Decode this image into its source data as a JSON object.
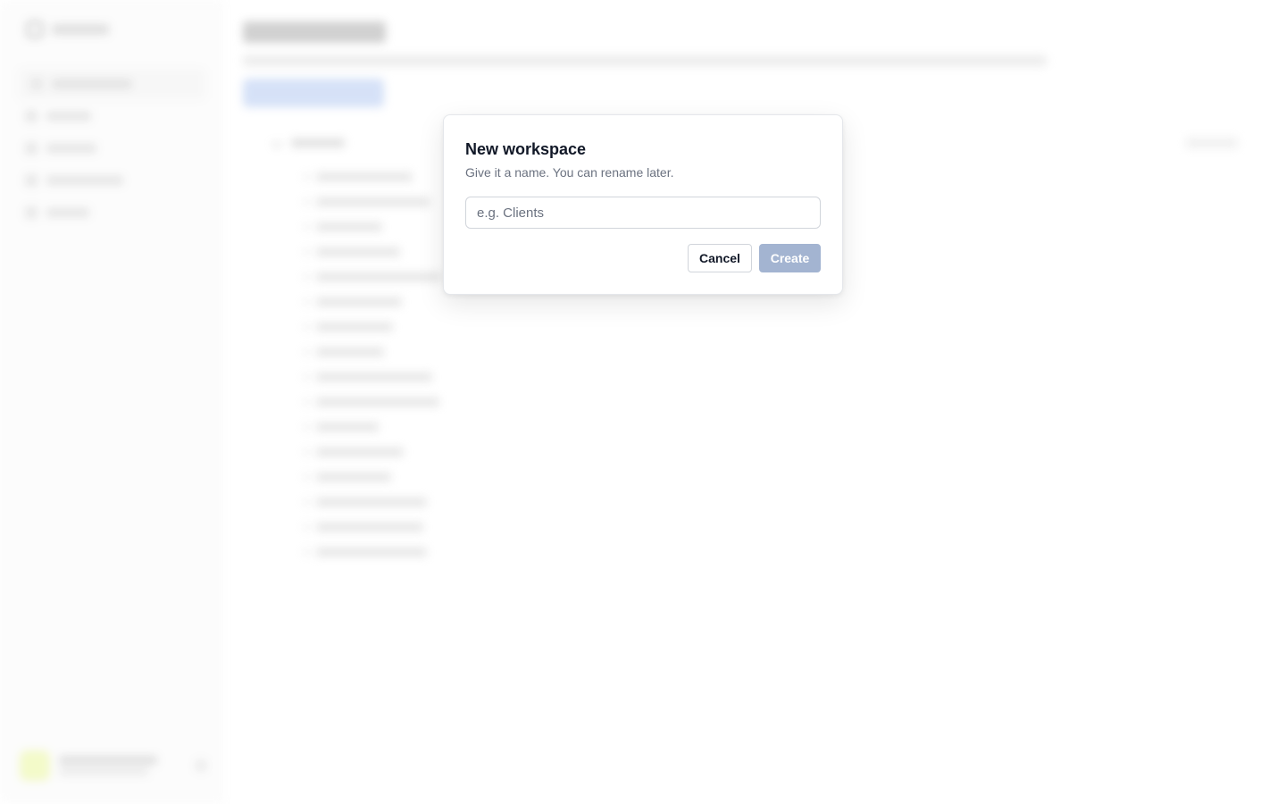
{
  "modal": {
    "title": "New workspace",
    "description": "Give it a name. You can rename later.",
    "input": {
      "value": "",
      "placeholder": "e.g. Clients"
    },
    "cancel_label": "Cancel",
    "create_label": "Create"
  },
  "colors": {
    "create_button_disabled": "#a3b4d1",
    "avatar": "#e7f58e",
    "primary_button_blurred": "#a8c1f0"
  }
}
